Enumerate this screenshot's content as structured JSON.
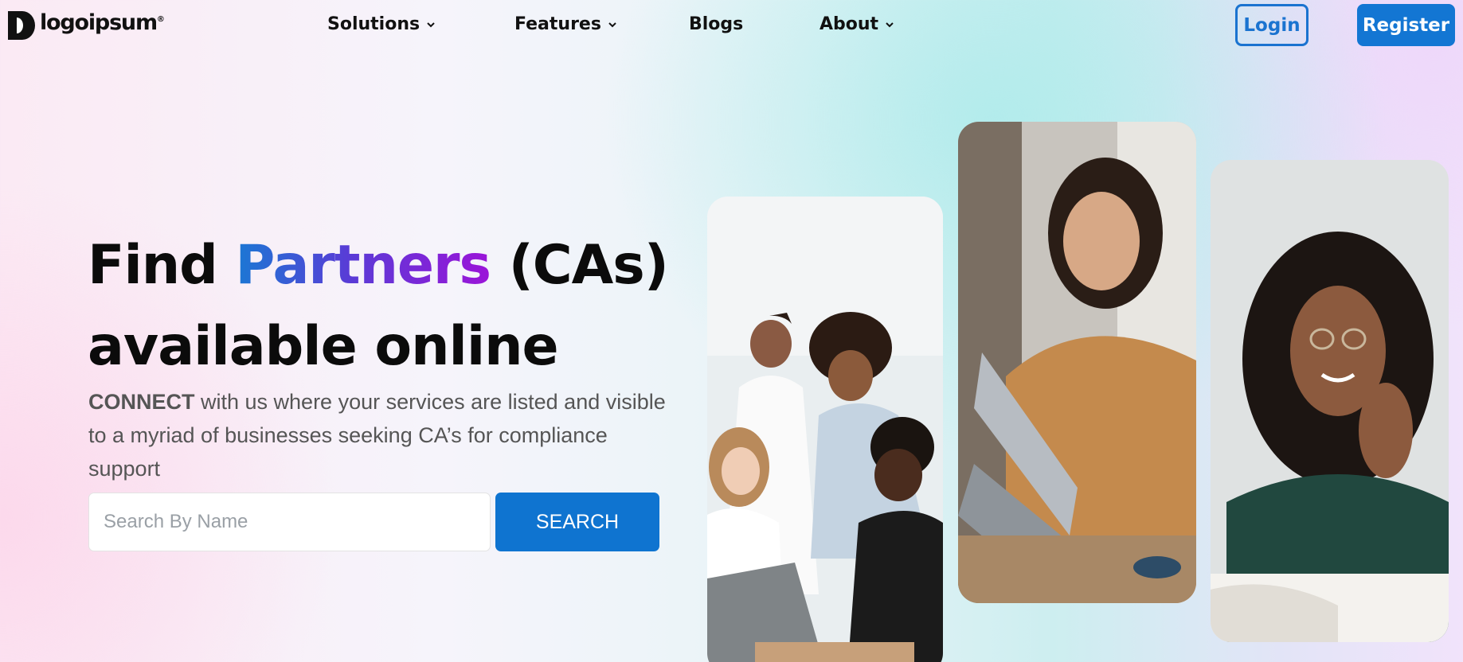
{
  "logo": {
    "text": "logoipsum",
    "mark": "®"
  },
  "nav": {
    "items": [
      {
        "label": "Solutions",
        "dropdown": true
      },
      {
        "label": "Features",
        "dropdown": true
      },
      {
        "label": "Blogs",
        "dropdown": false
      },
      {
        "label": "About",
        "dropdown": true
      }
    ],
    "login_label": "Login",
    "register_label": "Register"
  },
  "hero": {
    "title_part1": "Find ",
    "title_highlight": "Partners",
    "title_part2": " (CAs)",
    "title_line2": "available online",
    "desc_strong": "CONNECT",
    "desc_rest": " with us where your services are listed and visible to a myriad of businesses seeking CA’s for compliance support"
  },
  "search": {
    "placeholder": "Search By Name",
    "value": "",
    "button_label": "SEARCH"
  },
  "colors": {
    "accent": "#1376d3",
    "gradient_start": "#1b78d4",
    "gradient_end": "#9b14d8"
  },
  "photos": [
    {
      "icon": "team-meeting-photo"
    },
    {
      "icon": "woman-laptop-photo"
    },
    {
      "icon": "smiling-woman-photo"
    }
  ]
}
